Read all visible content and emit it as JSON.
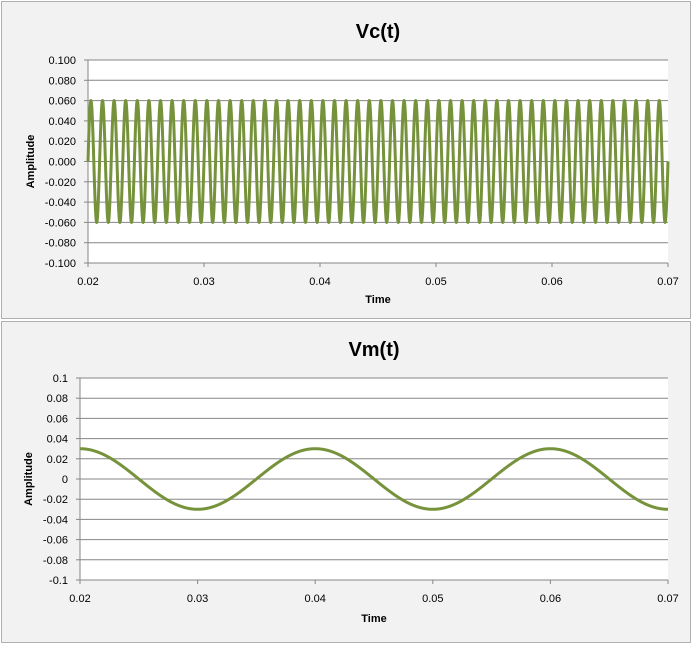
{
  "chart_data": [
    {
      "type": "line",
      "title": "Vc(t)",
      "xlabel": "Time",
      "ylabel": "Amplitude",
      "xlim": [
        0.02,
        0.07
      ],
      "ylim": [
        -0.1,
        0.1
      ],
      "x_ticks": [
        "0.02",
        "0.03",
        "0.04",
        "0.05",
        "0.06",
        "0.07"
      ],
      "y_ticks": [
        "0.100",
        "0.080",
        "0.060",
        "0.040",
        "0.020",
        "0.000",
        "-0.020",
        "-0.040",
        "-0.060",
        "-0.080",
        "-0.100"
      ],
      "grid": true,
      "legend": "none",
      "series": [
        {
          "function": "sine",
          "amplitude": 0.06,
          "frequency_hz": 1000,
          "phase": "sin",
          "color": "#76933c"
        }
      ]
    },
    {
      "type": "line",
      "title": "Vm(t)",
      "xlabel": "Time",
      "ylabel": "Amplitude",
      "xlim": [
        0.02,
        0.07
      ],
      "ylim": [
        -0.1,
        0.1
      ],
      "x_ticks": [
        "0.02",
        "0.03",
        "0.04",
        "0.05",
        "0.06",
        "0.07"
      ],
      "y_ticks": [
        "0.1",
        "0.08",
        "0.06",
        "0.04",
        "0.02",
        "0",
        "-0.02",
        "-0.04",
        "-0.06",
        "-0.08",
        "-0.1"
      ],
      "grid": true,
      "legend": "none",
      "series": [
        {
          "function": "sine",
          "amplitude": 0.03,
          "frequency_hz": 50,
          "phase": "cos",
          "color": "#76933c"
        }
      ]
    }
  ]
}
